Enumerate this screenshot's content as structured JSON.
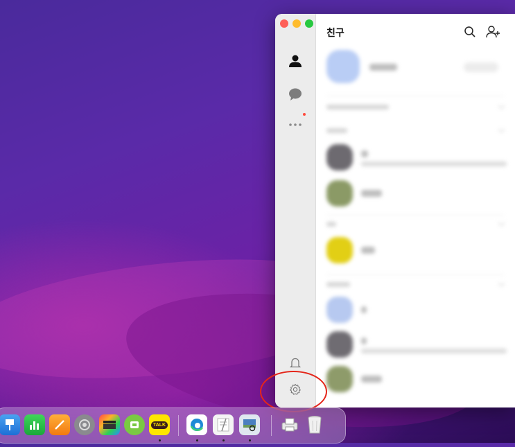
{
  "window": {
    "title": "친구",
    "sidebar": {
      "items": [
        {
          "icon": "person-icon",
          "selected": true
        },
        {
          "icon": "chat-bubble-icon"
        },
        {
          "icon": "more-icon",
          "badge_color": "#ff4a3d"
        },
        {
          "icon": "bell-icon"
        },
        {
          "icon": "gear-icon"
        }
      ]
    },
    "header_icons": [
      "search-icon",
      "add-friend-icon"
    ]
  },
  "dock": {
    "apps": [
      {
        "icon": "keynote-icon"
      },
      {
        "icon": "numbers-icon"
      },
      {
        "icon": "pages-icon"
      },
      {
        "icon": "system-preferences-icon"
      },
      {
        "icon": "final-cut-icon"
      },
      {
        "icon": "cloud-app-icon"
      },
      {
        "icon": "kakaotalk-icon",
        "label": "TALK",
        "running": true
      },
      {
        "icon": "edge-icon",
        "running": true
      },
      {
        "icon": "textedit-icon",
        "running": true
      },
      {
        "icon": "preview-icon",
        "running": true
      },
      {
        "icon": "printer-icon"
      },
      {
        "icon": "trash-icon"
      }
    ]
  },
  "colors": {
    "traffic_red": "#fe5f57",
    "traffic_yellow": "#febc2e",
    "traffic_green": "#28c840",
    "annotation": "#e4261a"
  }
}
